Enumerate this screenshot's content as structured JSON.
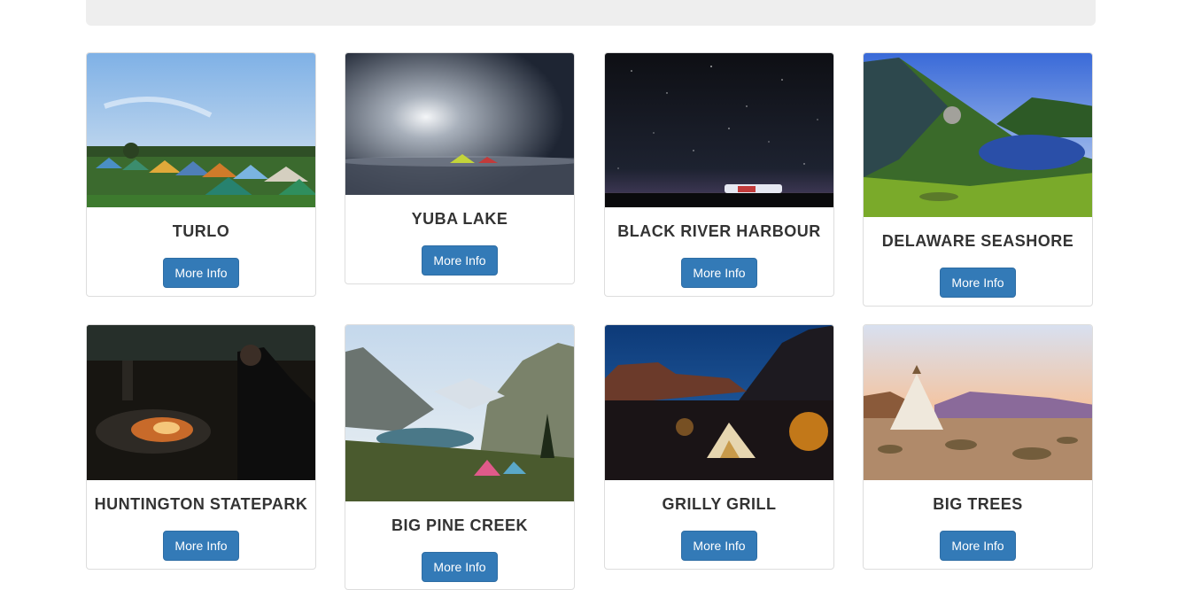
{
  "cards": [
    {
      "title": "TURLO",
      "button": "More Info",
      "image": "campground-tents-photo"
    },
    {
      "title": "YUBA LAKE",
      "button": "More Info",
      "image": "tent-under-cloudy-moon-photo"
    },
    {
      "title": "BLACK RIVER HARBOUR",
      "button": "More Info",
      "image": "starry-night-tent-photo"
    },
    {
      "title": "DELAWARE SEASHORE",
      "button": "More Info",
      "image": "mountain-lake-valley-photo"
    },
    {
      "title": "HUNTINGTON STATEPARK",
      "button": "More Info",
      "image": "campfire-at-night-photo"
    },
    {
      "title": "BIG PINE CREEK",
      "button": "More Info",
      "image": "alpine-lake-tents-photo"
    },
    {
      "title": "GRILLY GRILL",
      "button": "More Info",
      "image": "canyon-tent-at-dusk-photo"
    },
    {
      "title": "BIG TREES",
      "button": "More Info",
      "image": "teepee-desert-sunset-photo"
    }
  ]
}
